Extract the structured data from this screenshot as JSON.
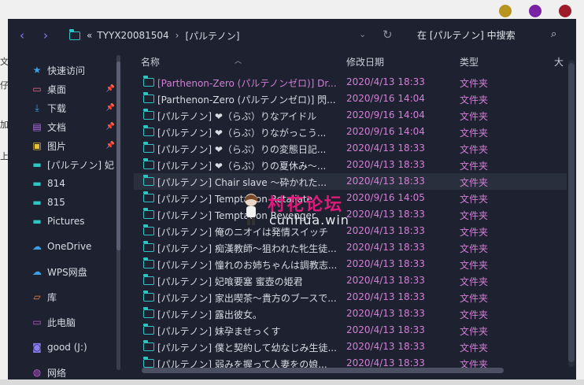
{
  "window_controls": [
    {
      "name": "minimize-dot",
      "color": "#b8951e"
    },
    {
      "name": "maximize-dot",
      "color": "#7a22a5"
    },
    {
      "name": "close-dot",
      "color": "#9e1b2a"
    }
  ],
  "toolbar": {
    "back_icon": "‹",
    "forward_icon": "›",
    "crumb_prefix": "«",
    "crumbs": [
      "TYYX20081504",
      "[パルテノン]"
    ],
    "crumb_sep": "›",
    "search_placeholder": "在 [パルテノン] 中搜索"
  },
  "sidebar": {
    "items": [
      {
        "label": "快速访问",
        "icon": "star-icon",
        "glyph": "★",
        "color": "#3aa0e8",
        "pinned": false
      },
      {
        "label": "桌面",
        "icon": "desktop-icon",
        "glyph": "▭",
        "color": "#e86b8a",
        "pinned": true
      },
      {
        "label": "下载",
        "icon": "download-icon",
        "glyph": "⤓",
        "color": "#3aa0e8",
        "pinned": true
      },
      {
        "label": "文档",
        "icon": "document-icon",
        "glyph": "▤",
        "color": "#b46ee8",
        "pinned": true
      },
      {
        "label": "图片",
        "icon": "picture-icon",
        "glyph": "▣",
        "color": "#e8c23a",
        "pinned": true
      },
      {
        "label": "[パルテノン] 妃",
        "icon": "folder-icon",
        "glyph": "▬",
        "color": "#2ec4c4",
        "pinned": false
      },
      {
        "label": "814",
        "icon": "folder-icon",
        "glyph": "▬",
        "color": "#2ec4c4",
        "pinned": false
      },
      {
        "label": "815",
        "icon": "folder-icon",
        "glyph": "▬",
        "color": "#2ec4c4",
        "pinned": false
      },
      {
        "label": "Pictures",
        "icon": "folder-icon",
        "glyph": "▬",
        "color": "#2ec4c4",
        "pinned": false
      },
      {
        "label": "OneDrive",
        "icon": "cloud-icon",
        "glyph": "☁",
        "color": "#3aa0e8",
        "pinned": false
      },
      {
        "label": "WPS网盘",
        "icon": "cloud-icon",
        "glyph": "☁",
        "color": "#3aa0e8",
        "pinned": false
      },
      {
        "label": "库",
        "icon": "library-icon",
        "glyph": "▱",
        "color": "#e8884a",
        "pinned": false
      },
      {
        "label": "此电脑",
        "icon": "computer-icon",
        "glyph": "▭",
        "color": "#c05ad6",
        "pinned": false
      },
      {
        "label": "good (J:)",
        "icon": "drive-icon",
        "glyph": "◙",
        "color": "#8a7cf0",
        "pinned": false
      },
      {
        "label": "网络",
        "icon": "network-icon",
        "glyph": "◍",
        "color": "#c05ad6",
        "pinned": false
      }
    ]
  },
  "columns": {
    "name": "名称",
    "date": "修改日期",
    "type": "类型",
    "size": "大"
  },
  "files": [
    {
      "name": "[Parthenon-Zero (パルテノンゼロ)] Dr...",
      "date": "2020/4/13 18:33",
      "type": "文件夹",
      "name_color": "#d27fd6"
    },
    {
      "name": "[Parthenon-Zero (パルテノンゼロ)] 閃...",
      "date": "2020/9/16 14:04",
      "type": "文件夹"
    },
    {
      "name": "[パルテノン] ❤（らぶ）りなアイドル",
      "date": "2020/9/16 14:04",
      "type": "文件夹"
    },
    {
      "name": "[パルテノン] ❤（らぶ）りながっこう...",
      "date": "2020/9/16 14:04",
      "type": "文件夹"
    },
    {
      "name": "[パルテノン] ❤（らぶ）りの変態日記...",
      "date": "2020/4/13 18:33",
      "type": "文件夹"
    },
    {
      "name": "[パルテノン] ❤（らぶ）りの夏休み～...",
      "date": "2020/4/13 18:33",
      "type": "文件夹"
    },
    {
      "name": "[パルテノン] Chair slave ～砕かれた...",
      "date": "2020/4/13 18:33",
      "type": "文件夹"
    },
    {
      "name": "[パルテノン] Temptation Retaliate",
      "date": "2020/9/16 14:05",
      "type": "文件夹"
    },
    {
      "name": "[パルテノン] Temptation Revenger",
      "date": "2020/4/13 18:33",
      "type": "文件夹"
    },
    {
      "name": "[パルテノン] 俺のニオイは発情スイッチ",
      "date": "2020/4/13 18:33",
      "type": "文件夹"
    },
    {
      "name": "[パルテノン] 痴漢教師～狙われた牝生徒...",
      "date": "2020/4/13 18:33",
      "type": "文件夹"
    },
    {
      "name": "[パルテノン] 憧れのお姉ちゃんは調教志...",
      "date": "2020/4/13 18:33",
      "type": "文件夹"
    },
    {
      "name": "[パルテノン] 妃喰要塞 蜜壺の姫君",
      "date": "2020/4/13 18:33",
      "type": "文件夹"
    },
    {
      "name": "[パルテノン] 家出喫茶～貴方のブースで...",
      "date": "2020/4/13 18:33",
      "type": "文件夹"
    },
    {
      "name": "[パルテノン] 露出彼女。",
      "date": "2020/4/13 18:33",
      "type": "文件夹"
    },
    {
      "name": "[パルテノン] 妹孕ませっくす",
      "date": "2020/4/13 18:33",
      "type": "文件夹"
    },
    {
      "name": "[パルテノン] 僕と契約して幼なじみ生徒...",
      "date": "2020/4/13 18:33",
      "type": "文件夹"
    },
    {
      "name": "[パルテノン] 弱みを握って人妻をの娘...",
      "date": "2020/4/13 18:33",
      "type": "文件夹"
    }
  ],
  "watermark": {
    "line1": "村花论坛",
    "line2": "cunhua.win"
  }
}
